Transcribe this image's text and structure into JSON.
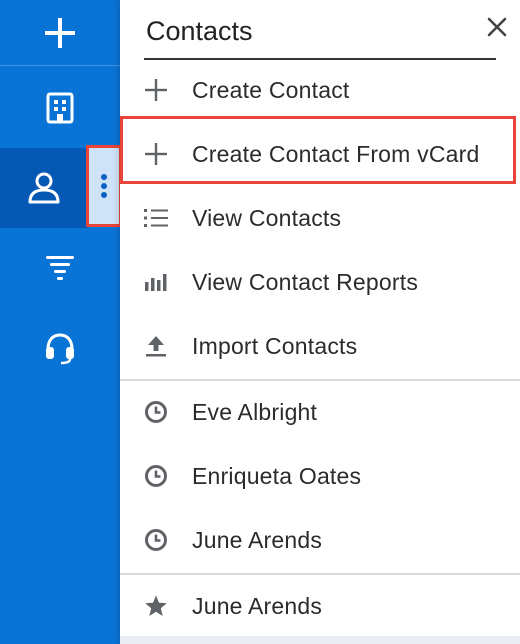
{
  "colors": {
    "rail_bg": "#0a74d6",
    "rail_active": "#0558b3",
    "highlight": "#e8443a",
    "icon_gray": "#5f6368"
  },
  "rail": {
    "items": [
      {
        "icon": "plus-icon"
      },
      {
        "icon": "building-icon"
      },
      {
        "icon": "person-icon"
      },
      {
        "icon": "funnel-icon"
      },
      {
        "icon": "headset-icon"
      }
    ],
    "more_icon": "kebab-icon"
  },
  "menu": {
    "title": "Contacts",
    "close_icon": "close-icon",
    "actions": [
      {
        "label": "Create Contact",
        "icon": "plus-icon"
      },
      {
        "label": "Create Contact From vCard",
        "icon": "plus-icon"
      },
      {
        "label": "View Contacts",
        "icon": "list-icon"
      },
      {
        "label": "View Contact Reports",
        "icon": "bar-chart-icon"
      },
      {
        "label": "Import Contacts",
        "icon": "upload-icon"
      }
    ],
    "recent": [
      {
        "label": "Eve Albright",
        "icon": "clock-icon"
      },
      {
        "label": "Enriqueta Oates",
        "icon": "clock-icon"
      },
      {
        "label": "June Arends",
        "icon": "clock-icon"
      }
    ],
    "favorites": [
      {
        "label": "June Arends",
        "icon": "star-icon"
      }
    ]
  }
}
